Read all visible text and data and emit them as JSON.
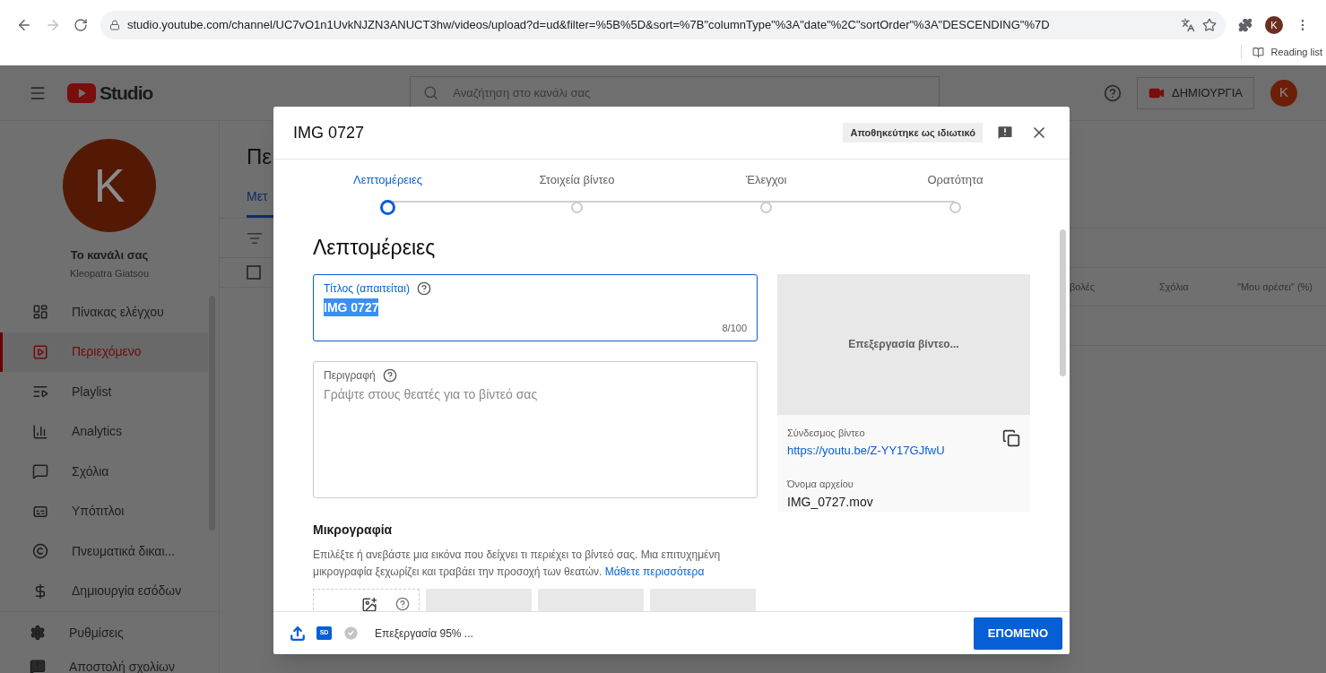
{
  "browser": {
    "url": "studio.youtube.com/channel/UC7vO1n1UvkNJZN3ANUCT3hw/videos/upload?d=ud&filter=%5B%5D&sort=%7B\"columnType\"%3A\"date\"%2C\"sortOrder\"%3A\"DESCENDING\"%7D",
    "profile_letter": "K",
    "reading_list": "Reading list"
  },
  "header": {
    "logo_text": "Studio",
    "search_placeholder": "Αναζήτηση στο κανάλι σας",
    "create_label": "ΔΗΜΙΟΥΡΓΙΑ",
    "avatar_letter": "K"
  },
  "sidebar": {
    "avatar_letter": "K",
    "channel_title": "Το κανάλι σας",
    "channel_name": "Kleopatra Giatsou",
    "items": [
      {
        "label": "Πίνακας ελέγχου",
        "selected": false
      },
      {
        "label": "Περιεχόμενο",
        "selected": true
      },
      {
        "label": "Playlist",
        "selected": false
      },
      {
        "label": "Analytics",
        "selected": false
      },
      {
        "label": "Σχόλια",
        "selected": false
      },
      {
        "label": "Υπότιτλοι",
        "selected": false
      },
      {
        "label": "Πνευματικά δικαι...",
        "selected": false
      },
      {
        "label": "Δημιουργία εσόδων",
        "selected": false
      }
    ],
    "footer_items": [
      {
        "label": "Ρυθμίσεις"
      },
      {
        "label": "Αποστολή σχολίων"
      }
    ]
  },
  "background": {
    "heading": "Πε",
    "tab": "Μετ",
    "select_all": {
      "checked": false
    },
    "columns": [
      "βολές",
      "Σχόλια",
      "\"Μου αρέσει\" (%)"
    ]
  },
  "dialog": {
    "title": "IMG 0727",
    "saved_badge": "Αποθηκεύτηκε ως ιδιωτικό",
    "steps": [
      {
        "label": "Λεπτομέρειες",
        "selected": true
      },
      {
        "label": "Στοιχεία βίντεο",
        "selected": false
      },
      {
        "label": "Έλεγχοι",
        "selected": false
      },
      {
        "label": "Ορατότητα",
        "selected": false
      }
    ],
    "section_title": "Λεπτομέρειες",
    "title_field": {
      "label": "Τίτλος (απαιτείται)",
      "value": "IMG 0727",
      "counter": "8/100"
    },
    "description_field": {
      "label": "Περιγραφή",
      "placeholder": "Γράψτε στους θεατές για το βίντεό σας"
    },
    "thumbnail": {
      "heading": "Μικρογραφία",
      "text": "Επιλέξτε ή ανεβάστε μια εικόνα που δείχνει τι περιέχει το βίντεό σας. Μια επιτυχημένη μικρογραφία ξεχωρίζει και τραβάει την προσοχή των θεατών.",
      "link": "Μάθετε περισσότερα"
    },
    "preview": {
      "status": "Επεξεργασία βίντεο...",
      "link_label": "Σύνδεσμος βίντεο",
      "link": "https://youtu.be/Z-YY17GJfwU",
      "file_label": "Όνομα αρχείου",
      "file_name": "IMG_0727.mov"
    },
    "footer": {
      "quality_badge": "SD",
      "status": "Επεξεργασία 95% ...",
      "next_button": "ΕΠΟΜΕΝΟ"
    }
  }
}
